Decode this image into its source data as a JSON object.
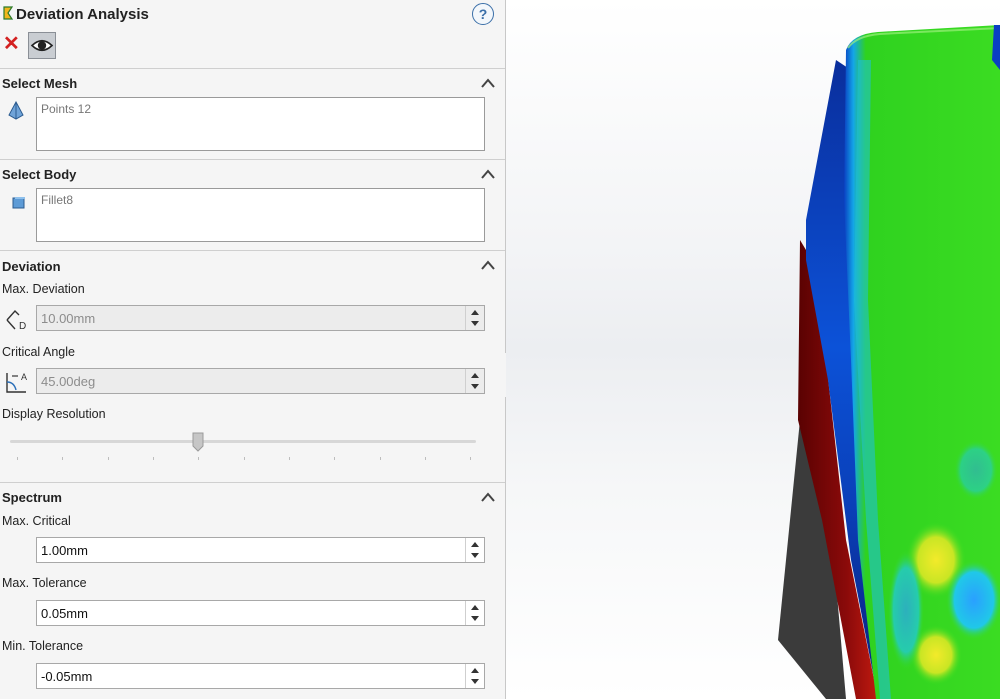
{
  "panel": {
    "title": "Deviation Analysis",
    "help_glyph": "?",
    "close_glyph": "✕",
    "icons": [
      "app-logo-icon",
      "help-icon",
      "close-icon",
      "eye-icon"
    ]
  },
  "select_mesh": {
    "title": "Select Mesh",
    "value": "Points 12"
  },
  "select_body": {
    "title": "Select Body",
    "value": "Fillet8"
  },
  "deviation": {
    "title": "Deviation",
    "max_deviation_label": "Max. Deviation",
    "max_deviation_value": "10.00mm",
    "critical_angle_label": "Critical Angle",
    "critical_angle_value": "45.00deg",
    "display_resolution_label": "Display Resolution",
    "display_resolution_level": 0.4
  },
  "spectrum": {
    "title": "Spectrum",
    "max_critical_label": "Max. Critical",
    "max_critical_value": "1.00mm",
    "max_tolerance_label": "Max. Tolerance",
    "max_tolerance_value": "0.05mm",
    "min_tolerance_label": "Min. Tolerance",
    "min_tolerance_value": "-0.05mm"
  },
  "colors": {
    "accent_blue": "#3b6fa8",
    "close_red": "#d32020",
    "deviation_green": "#2fd21f",
    "deviation_blue": "#0a4bd6",
    "deviation_red": "#8a0a0a"
  }
}
